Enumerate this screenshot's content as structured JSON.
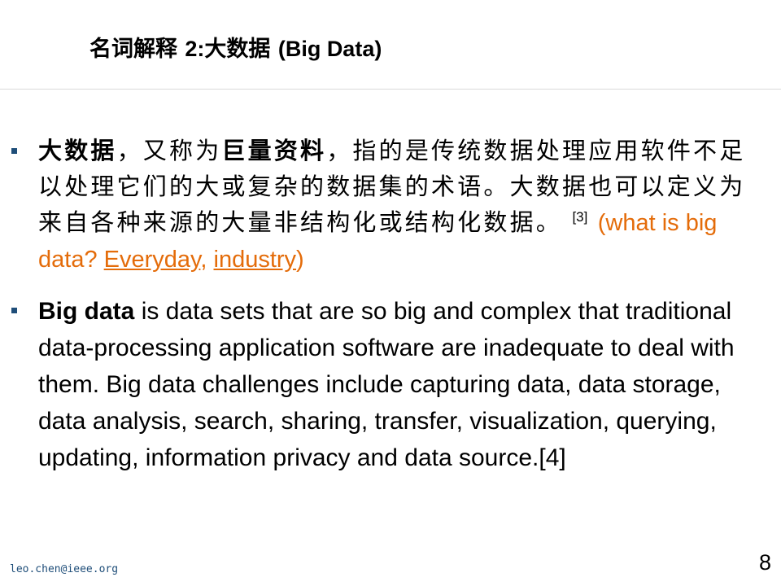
{
  "slide": {
    "title_cn": "名词解释",
    "title_num": "2:",
    "title_cn2": "大数据",
    "title_en": "(Big Data)"
  },
  "bullet1": {
    "bold1": "大数据",
    "t1": "，又称为",
    "bold2": "巨量资料",
    "t2": "，指的是传统数据处理应用软件不足以处理它们的大或复杂的数据集的术语。大数据也可以定义为来自各种来源的大量非结构化或结构化数据。",
    "ref": "[3]",
    "paren_open": "(what is big data? ",
    "link1": "Everyday",
    "comma": ", ",
    "link2": "industry",
    "paren_close": ")"
  },
  "bullet2": {
    "bold": "Big data",
    "text": " is data sets that are so big and complex that traditional data-processing application software are inadequate to deal with them. Big data challenges include capturing data, data storage, data analysis, search, sharing, transfer, visualization, querying, updating, information privacy and data source.[4]"
  },
  "footer": {
    "email": "leo.chen@ieee.org",
    "page": "8"
  },
  "colors": {
    "accent_orange": "#e46c0a",
    "bullet_blue": "#1f4e79"
  }
}
